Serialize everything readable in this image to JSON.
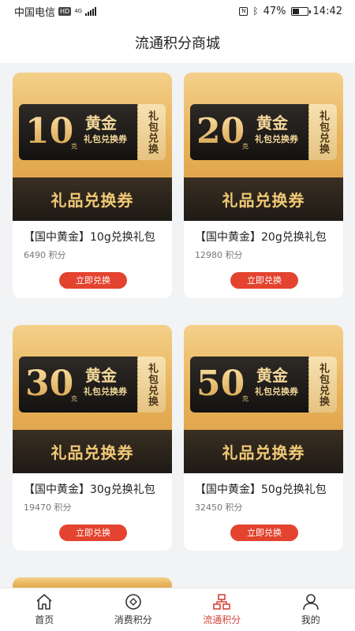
{
  "status": {
    "carrier": "中国电信",
    "hd": "HD",
    "network": "4G",
    "nfc": "N",
    "battery": "47%",
    "battery_level": 0.47,
    "time": "14:42"
  },
  "header": {
    "title": "流通积分商城"
  },
  "coupon_common": {
    "gold_title": "黄金",
    "sub": "礼包兑换券",
    "unit": "克",
    "side": "礼包兑换",
    "footer": "礼品兑换券"
  },
  "products": [
    {
      "amount": "10",
      "title": "【国中黄金】10g兑换礼包",
      "points": "6490 积分",
      "button": "立即兑换"
    },
    {
      "amount": "20",
      "title": "【国中黄金】20g兑换礼包",
      "points": "12980 积分",
      "button": "立即兑换"
    },
    {
      "amount": "30",
      "title": "【国中黄金】30g兑换礼包",
      "points": "19470 积分",
      "button": "立即兑换"
    },
    {
      "amount": "50",
      "title": "【国中黄金】50g兑换礼包",
      "points": "32450 积分",
      "button": "立即兑换"
    }
  ],
  "tabbar": [
    {
      "label": "首页",
      "icon": "home-icon",
      "active": false
    },
    {
      "label": "消费积分",
      "icon": "coin-icon",
      "active": false
    },
    {
      "label": "流通积分",
      "icon": "network-icon",
      "active": true
    },
    {
      "label": "我的",
      "icon": "user-icon",
      "active": false
    }
  ],
  "colors": {
    "accent": "#d4453c",
    "button": "#e3432f",
    "background": "#f2f3f5"
  }
}
